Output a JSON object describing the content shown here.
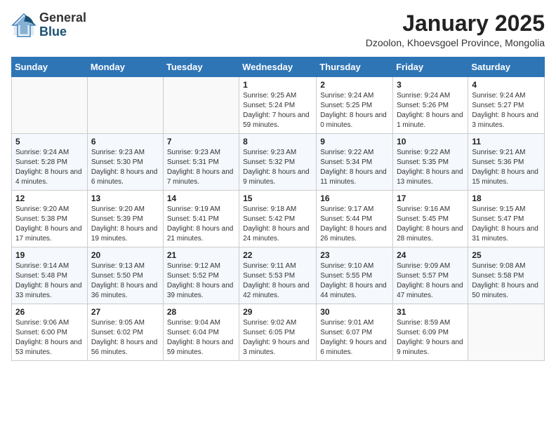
{
  "logo": {
    "general": "General",
    "blue": "Blue"
  },
  "header": {
    "month": "January 2025",
    "location": "Dzoolon, Khoevsgoel Province, Mongolia"
  },
  "weekdays": [
    "Sunday",
    "Monday",
    "Tuesday",
    "Wednesday",
    "Thursday",
    "Friday",
    "Saturday"
  ],
  "weeks": [
    [
      {
        "day": "",
        "info": ""
      },
      {
        "day": "",
        "info": ""
      },
      {
        "day": "",
        "info": ""
      },
      {
        "day": "1",
        "info": "Sunrise: 9:25 AM\nSunset: 5:24 PM\nDaylight: 7 hours and 59 minutes."
      },
      {
        "day": "2",
        "info": "Sunrise: 9:24 AM\nSunset: 5:25 PM\nDaylight: 8 hours and 0 minutes."
      },
      {
        "day": "3",
        "info": "Sunrise: 9:24 AM\nSunset: 5:26 PM\nDaylight: 8 hours and 1 minute."
      },
      {
        "day": "4",
        "info": "Sunrise: 9:24 AM\nSunset: 5:27 PM\nDaylight: 8 hours and 3 minutes."
      }
    ],
    [
      {
        "day": "5",
        "info": "Sunrise: 9:24 AM\nSunset: 5:28 PM\nDaylight: 8 hours and 4 minutes."
      },
      {
        "day": "6",
        "info": "Sunrise: 9:23 AM\nSunset: 5:30 PM\nDaylight: 8 hours and 6 minutes."
      },
      {
        "day": "7",
        "info": "Sunrise: 9:23 AM\nSunset: 5:31 PM\nDaylight: 8 hours and 7 minutes."
      },
      {
        "day": "8",
        "info": "Sunrise: 9:23 AM\nSunset: 5:32 PM\nDaylight: 8 hours and 9 minutes."
      },
      {
        "day": "9",
        "info": "Sunrise: 9:22 AM\nSunset: 5:34 PM\nDaylight: 8 hours and 11 minutes."
      },
      {
        "day": "10",
        "info": "Sunrise: 9:22 AM\nSunset: 5:35 PM\nDaylight: 8 hours and 13 minutes."
      },
      {
        "day": "11",
        "info": "Sunrise: 9:21 AM\nSunset: 5:36 PM\nDaylight: 8 hours and 15 minutes."
      }
    ],
    [
      {
        "day": "12",
        "info": "Sunrise: 9:20 AM\nSunset: 5:38 PM\nDaylight: 8 hours and 17 minutes."
      },
      {
        "day": "13",
        "info": "Sunrise: 9:20 AM\nSunset: 5:39 PM\nDaylight: 8 hours and 19 minutes."
      },
      {
        "day": "14",
        "info": "Sunrise: 9:19 AM\nSunset: 5:41 PM\nDaylight: 8 hours and 21 minutes."
      },
      {
        "day": "15",
        "info": "Sunrise: 9:18 AM\nSunset: 5:42 PM\nDaylight: 8 hours and 24 minutes."
      },
      {
        "day": "16",
        "info": "Sunrise: 9:17 AM\nSunset: 5:44 PM\nDaylight: 8 hours and 26 minutes."
      },
      {
        "day": "17",
        "info": "Sunrise: 9:16 AM\nSunset: 5:45 PM\nDaylight: 8 hours and 28 minutes."
      },
      {
        "day": "18",
        "info": "Sunrise: 9:15 AM\nSunset: 5:47 PM\nDaylight: 8 hours and 31 minutes."
      }
    ],
    [
      {
        "day": "19",
        "info": "Sunrise: 9:14 AM\nSunset: 5:48 PM\nDaylight: 8 hours and 33 minutes."
      },
      {
        "day": "20",
        "info": "Sunrise: 9:13 AM\nSunset: 5:50 PM\nDaylight: 8 hours and 36 minutes."
      },
      {
        "day": "21",
        "info": "Sunrise: 9:12 AM\nSunset: 5:52 PM\nDaylight: 8 hours and 39 minutes."
      },
      {
        "day": "22",
        "info": "Sunrise: 9:11 AM\nSunset: 5:53 PM\nDaylight: 8 hours and 42 minutes."
      },
      {
        "day": "23",
        "info": "Sunrise: 9:10 AM\nSunset: 5:55 PM\nDaylight: 8 hours and 44 minutes."
      },
      {
        "day": "24",
        "info": "Sunrise: 9:09 AM\nSunset: 5:57 PM\nDaylight: 8 hours and 47 minutes."
      },
      {
        "day": "25",
        "info": "Sunrise: 9:08 AM\nSunset: 5:58 PM\nDaylight: 8 hours and 50 minutes."
      }
    ],
    [
      {
        "day": "26",
        "info": "Sunrise: 9:06 AM\nSunset: 6:00 PM\nDaylight: 8 hours and 53 minutes."
      },
      {
        "day": "27",
        "info": "Sunrise: 9:05 AM\nSunset: 6:02 PM\nDaylight: 8 hours and 56 minutes."
      },
      {
        "day": "28",
        "info": "Sunrise: 9:04 AM\nSunset: 6:04 PM\nDaylight: 8 hours and 59 minutes."
      },
      {
        "day": "29",
        "info": "Sunrise: 9:02 AM\nSunset: 6:05 PM\nDaylight: 9 hours and 3 minutes."
      },
      {
        "day": "30",
        "info": "Sunrise: 9:01 AM\nSunset: 6:07 PM\nDaylight: 9 hours and 6 minutes."
      },
      {
        "day": "31",
        "info": "Sunrise: 8:59 AM\nSunset: 6:09 PM\nDaylight: 9 hours and 9 minutes."
      },
      {
        "day": "",
        "info": ""
      }
    ]
  ]
}
